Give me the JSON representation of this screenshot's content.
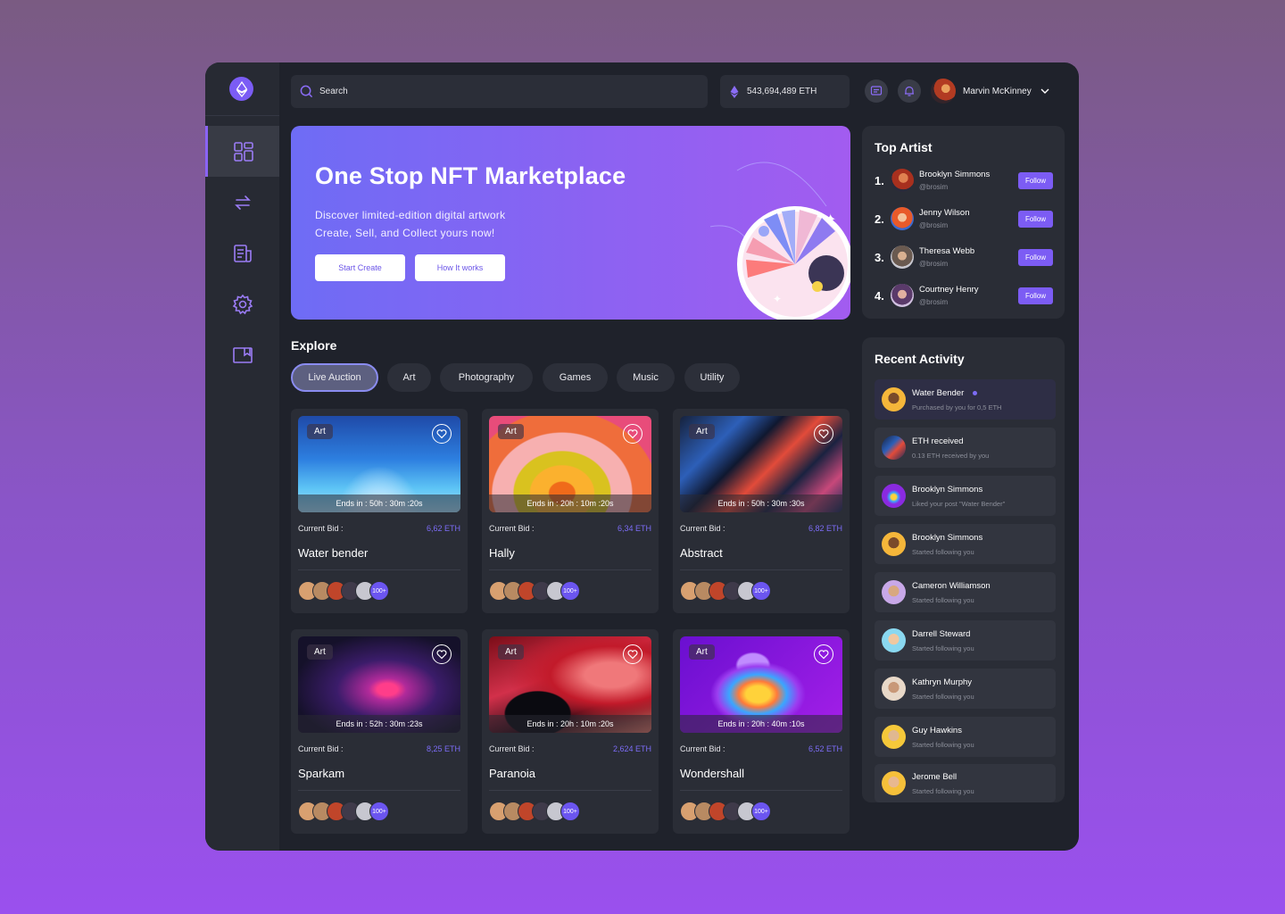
{
  "search": {
    "placeholder": "Search"
  },
  "wallet": {
    "balance": "543,694,489 ETH"
  },
  "user": {
    "name": "Marvin McKinney"
  },
  "hero": {
    "title": "One Stop NFT Marketplace",
    "line1": "Discover limited-edition digital artwork",
    "line2": "Create, Sell, and Collect yours now!",
    "primary_btn": "Start Create",
    "secondary_btn": "How It works"
  },
  "explore": {
    "title": "Explore",
    "categories": [
      "Live Auction",
      "Art",
      "Photography",
      "Games",
      "Music",
      "Utility"
    ],
    "active_category": "Live Auction",
    "bid_label": "Current Bid :",
    "more_bidders": "100+",
    "cards": [
      {
        "tag": "Art",
        "timer": "Ends in : 50h : 30m :20s",
        "bid": "6,62 ETH",
        "name": "Water bender"
      },
      {
        "tag": "Art",
        "timer": "Ends in : 20h : 10m :20s",
        "bid": "6,34 ETH",
        "name": "Hally"
      },
      {
        "tag": "Art",
        "timer": "Ends in : 50h : 30m :30s",
        "bid": "6,82 ETH",
        "name": "Abstract"
      },
      {
        "tag": "Art",
        "timer": "Ends in : 52h : 30m :23s",
        "bid": "8,25 ETH",
        "name": "Sparkam"
      },
      {
        "tag": "Art",
        "timer": "Ends in : 20h : 10m :20s",
        "bid": "2,624 ETH",
        "name": "Paranoia"
      },
      {
        "tag": "Art",
        "timer": "Ends in : 20h : 40m :10s",
        "bid": "6,52 ETH",
        "name": "Wondershall"
      }
    ]
  },
  "top_artist": {
    "title": "Top Artist",
    "follow_label": "Follow",
    "items": [
      {
        "rank": "1.",
        "name": "Brooklyn Simmons",
        "handle": "@brosim"
      },
      {
        "rank": "2.",
        "name": "Jenny Wilson",
        "handle": "@brosim"
      },
      {
        "rank": "3.",
        "name": "Theresa Webb",
        "handle": "@brosim"
      },
      {
        "rank": "4.",
        "name": "Courtney Henry",
        "handle": "@brosim"
      }
    ]
  },
  "recent_activity": {
    "title": "Recent Activity",
    "items": [
      {
        "title": "Water Bender",
        "sub": "Purchased by you for 0,5 ETH"
      },
      {
        "title": "ETH received",
        "sub": "0.13 ETH received by you"
      },
      {
        "title": "Brooklyn Simmons",
        "sub": "Liked your post \"Water Bender\""
      },
      {
        "title": "Brooklyn Simmons",
        "sub": "Started following you"
      },
      {
        "title": "Cameron Williamson",
        "sub": "Started following you"
      },
      {
        "title": "Darrell Steward",
        "sub": "Started following you"
      },
      {
        "title": "Kathryn Murphy",
        "sub": "Started following you"
      },
      {
        "title": "Guy Hawkins",
        "sub": "Started following you"
      },
      {
        "title": "Jerome Bell",
        "sub": "Started following you"
      }
    ]
  },
  "colors": {
    "accent": "#7c5cf4",
    "panel": "#2a2d36",
    "background": "#1f222b"
  },
  "icons": {
    "sidebar": [
      "dashboard-icon",
      "transfer-icon",
      "document-icon",
      "settings-icon",
      "wallet-icon"
    ],
    "topbar": [
      "search-icon",
      "ethereum-icon",
      "message-icon",
      "bell-icon",
      "chevron-down-icon"
    ]
  }
}
